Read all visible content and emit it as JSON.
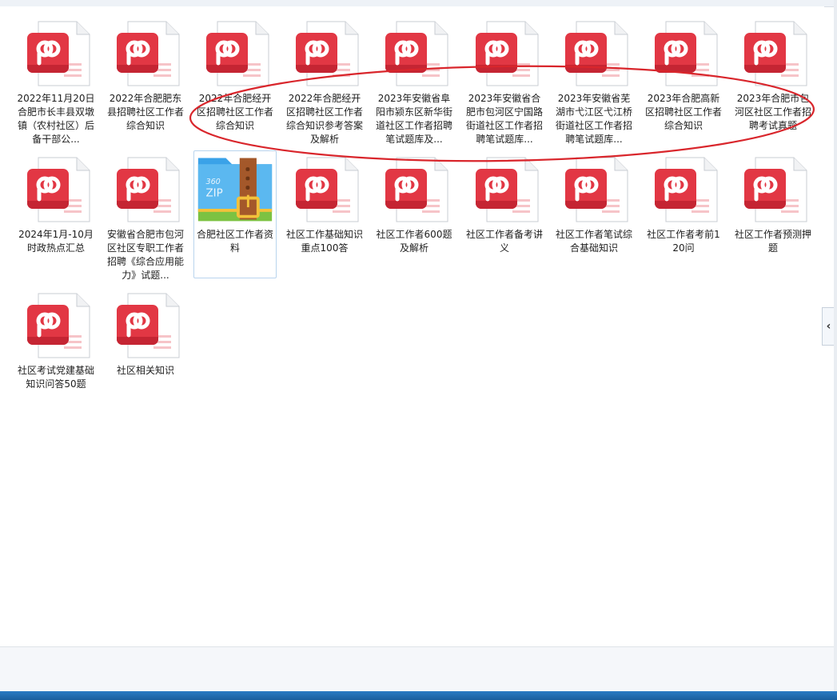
{
  "files": [
    {
      "name": "2022年11月20日合肥市长丰县双墩镇（农村社区）后备干部公...",
      "type": "pdf",
      "icon": "pdf-icon"
    },
    {
      "name": "2022年合肥肥东县招聘社区工作者综合知识",
      "type": "pdf",
      "icon": "pdf-icon"
    },
    {
      "name": "2022年合肥经开区招聘社区工作者综合知识",
      "type": "pdf",
      "icon": "pdf-icon"
    },
    {
      "name": "2022年合肥经开区招聘社区工作者综合知识参考答案及解析",
      "type": "pdf",
      "icon": "pdf-icon"
    },
    {
      "name": "2023年安徽省阜阳市颍东区新华街道社区工作者招聘笔试题库及...",
      "type": "pdf",
      "icon": "pdf-icon"
    },
    {
      "name": "2023年安徽省合肥市包河区宁国路街道社区工作者招聘笔试题库...",
      "type": "pdf",
      "icon": "pdf-icon"
    },
    {
      "name": "2023年安徽省芜湖市弋江区弋江桥街道社区工作者招聘笔试题库...",
      "type": "pdf",
      "icon": "pdf-icon"
    },
    {
      "name": "2023年合肥高新区招聘社区工作者综合知识",
      "type": "pdf",
      "icon": "pdf-icon"
    },
    {
      "name": "2023年合肥市包河区社区工作者招聘考试真题",
      "type": "pdf",
      "icon": "pdf-icon"
    },
    {
      "name": "2024年1月-10月时政热点汇总",
      "type": "pdf",
      "icon": "pdf-icon"
    },
    {
      "name": "安徽省合肥市包河区社区专职工作者招聘《综合应用能力》试题...",
      "type": "pdf",
      "icon": "pdf-icon"
    },
    {
      "name": "合肥社区工作者资料",
      "type": "zip",
      "icon": "zip-archive-icon",
      "selected": true
    },
    {
      "name": "社区工作基础知识重点100答",
      "type": "pdf",
      "icon": "pdf-icon"
    },
    {
      "name": "社区工作者600题及解析",
      "type": "pdf",
      "icon": "pdf-icon"
    },
    {
      "name": "社区工作者备考讲义",
      "type": "pdf",
      "icon": "pdf-icon"
    },
    {
      "name": "社区工作者笔试综合基础知识",
      "type": "pdf",
      "icon": "pdf-icon"
    },
    {
      "name": "社区工作者考前120问",
      "type": "pdf",
      "icon": "pdf-icon"
    },
    {
      "name": "社区工作者预测押题",
      "type": "pdf",
      "icon": "pdf-icon"
    },
    {
      "name": "社区考试党建基础知识问答50题",
      "type": "pdf",
      "icon": "pdf-icon"
    },
    {
      "name": "社区相关知识",
      "type": "pdf",
      "icon": "pdf-icon"
    }
  ],
  "zip_badge": {
    "line1": "360",
    "line2": "ZIP"
  },
  "collapse_glyph": "‹",
  "colors": {
    "pdf_red": "#e23744",
    "annotation_red": "#d9262c",
    "zip_blue": "#3aa2e8",
    "zip_green": "#7cc242",
    "zip_strap": "#a4582a"
  }
}
